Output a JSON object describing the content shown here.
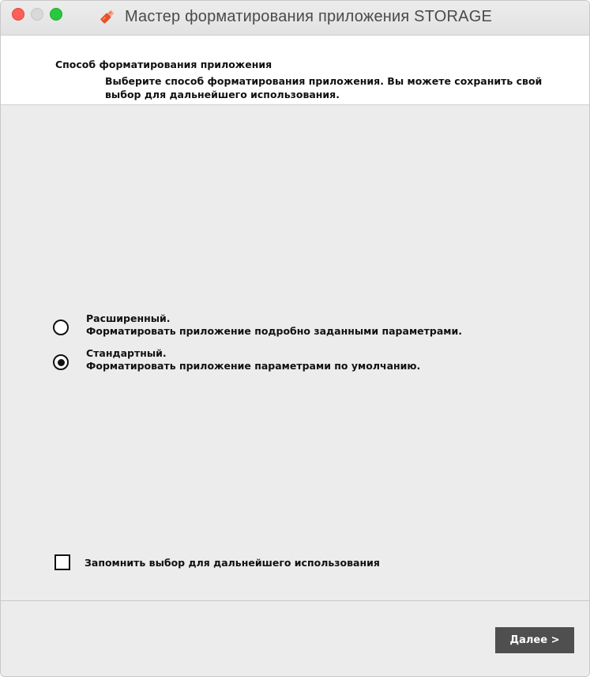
{
  "window": {
    "title": "Мастер форматирования приложения STORAGE",
    "app_icon": "usb-key-icon",
    "controls": [
      "close",
      "minimize",
      "zoom"
    ]
  },
  "header": {
    "title": "Способ форматирования приложения",
    "description": "Выберите способ форматирования приложения. Вы можете сохранить свой выбор для дальнейшего использования."
  },
  "options": [
    {
      "label": "Расширенный.",
      "description": "Форматировать приложение подробно заданными параметрами.",
      "selected": false
    },
    {
      "label": "Стандартный.",
      "description": "Форматировать приложение параметрами по умолчанию.",
      "selected": true
    }
  ],
  "remember": {
    "label": "Запомнить выбор для дальнейшего использования",
    "checked": false
  },
  "footer": {
    "next_label": "Далее >"
  },
  "colors": {
    "button_bg": "#4f4f4f",
    "close": "#fe5f57",
    "zoom": "#28c840",
    "app_icon": "#e8502a"
  }
}
